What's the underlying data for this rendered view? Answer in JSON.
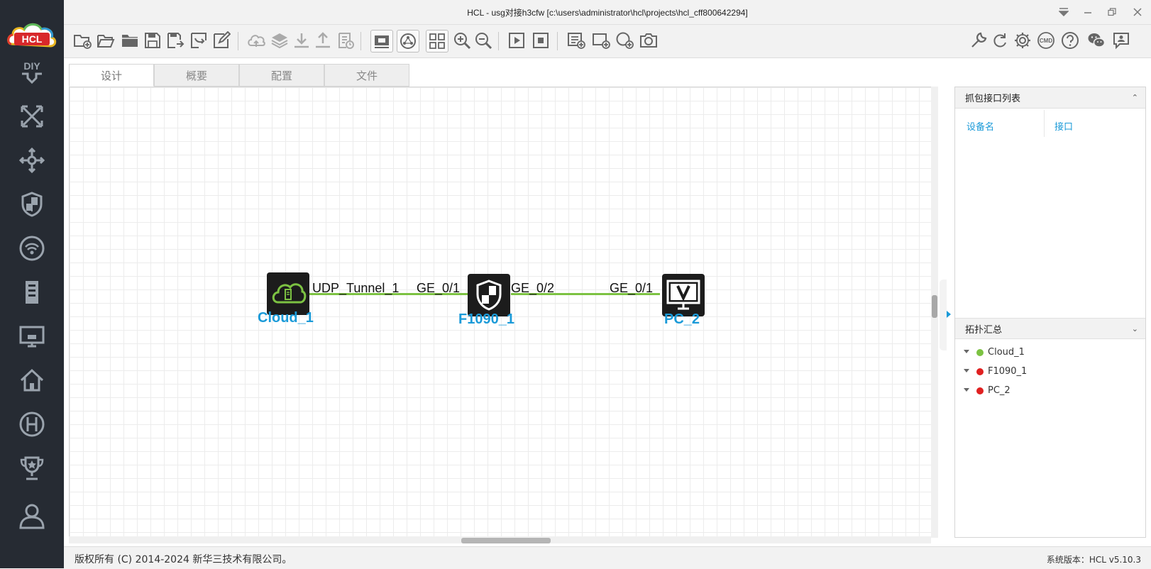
{
  "window": {
    "title": "HCL - usg对接h3cfw [c:\\users\\administrator\\hcl\\projects\\hcl_cff800642294]"
  },
  "sidebar": {
    "logo_text": "HCL",
    "items": [
      {
        "icon": "diy-icon"
      },
      {
        "icon": "router-icon"
      },
      {
        "icon": "switch-icon"
      },
      {
        "icon": "firewall-icon"
      },
      {
        "icon": "wireless-icon"
      },
      {
        "icon": "server-icon"
      },
      {
        "icon": "terminal-icon"
      },
      {
        "icon": "home-icon"
      },
      {
        "icon": "h3c-icon"
      },
      {
        "icon": "trophy-icon"
      },
      {
        "icon": "user-icon"
      }
    ]
  },
  "tabs": [
    {
      "label": "设计",
      "active": true
    },
    {
      "label": "概要",
      "active": false
    },
    {
      "label": "配置",
      "active": false
    },
    {
      "label": "文件",
      "active": false
    }
  ],
  "topology": {
    "devices": [
      {
        "name": "Cloud_1",
        "type": "cloud"
      },
      {
        "name": "F1090_1",
        "type": "firewall"
      },
      {
        "name": "PC_2",
        "type": "pc"
      }
    ],
    "links": [
      {
        "a_port": "UDP_Tunnel_1",
        "b_port": "GE_0/1"
      },
      {
        "a_port": "GE_0/2",
        "b_port": "GE_0/1"
      }
    ],
    "link_color": "#7cc242"
  },
  "capture_panel": {
    "title": "抓包接口列表",
    "toggle": "⌃",
    "columns": [
      "设备名",
      "接口"
    ]
  },
  "summary_panel": {
    "title": "拓扑汇总",
    "toggle": "⌄",
    "items": [
      {
        "label": "Cloud_1",
        "status_color": "#7cc242"
      },
      {
        "label": "F1090_1",
        "status_color": "#e02020"
      },
      {
        "label": "PC_2",
        "status_color": "#e02020"
      }
    ]
  },
  "status": {
    "copyright": "版权所有 (C) 2014-2024 新华三技术有限公司。",
    "version": "系统版本：HCL v5.10.3"
  },
  "colors": {
    "accent": "#1a9ad8",
    "sidebar_bg": "#262b33"
  }
}
